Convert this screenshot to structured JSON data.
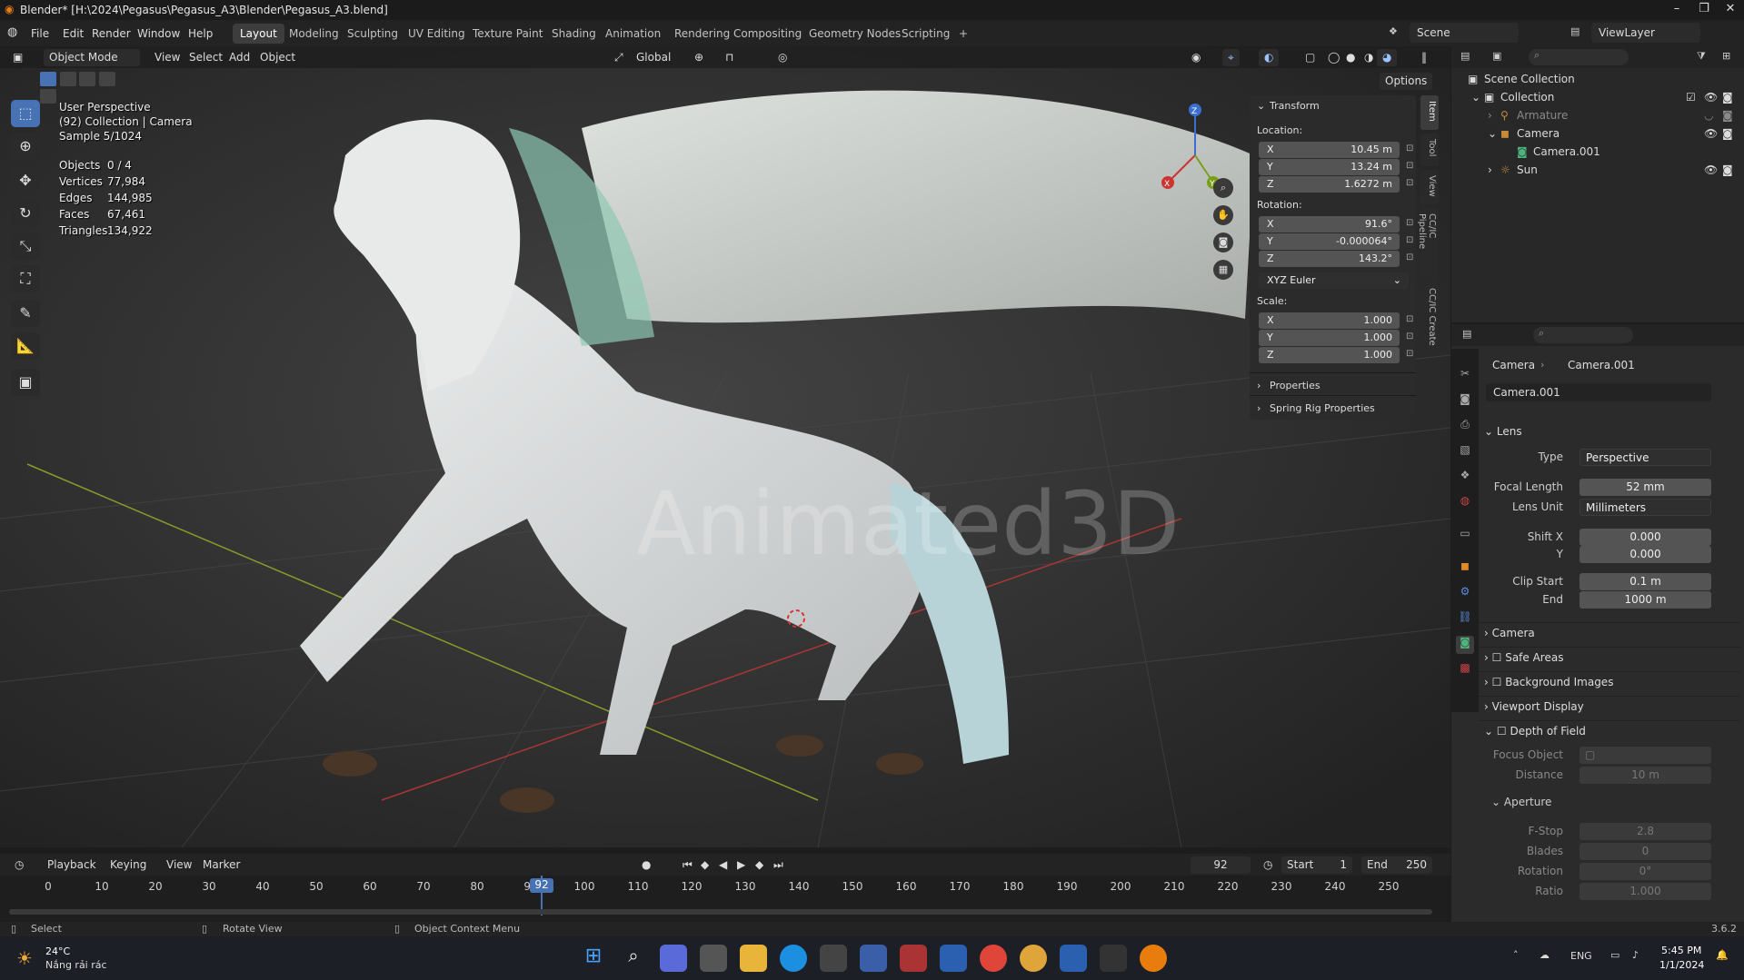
{
  "window": {
    "title": "Blender* [H:\\2024\\Pegasus\\Pegasus_A3\\Blender\\Pegasus_A3.blend]",
    "minimize": "–",
    "maximize": "❐",
    "close": "✕"
  },
  "menu": [
    "File",
    "Edit",
    "Render",
    "Window",
    "Help"
  ],
  "workspaces": [
    "Layout",
    "Modeling",
    "Sculpting",
    "UV Editing",
    "Texture Paint",
    "Shading",
    "Animation",
    "Rendering",
    "Compositing",
    "Geometry Nodes",
    "Scripting",
    "+"
  ],
  "scene": {
    "label": "Scene",
    "view_layer": "ViewLayer"
  },
  "viewport_header": {
    "mode": "Object Mode",
    "menus": [
      "View",
      "Select",
      "Add",
      "Object"
    ],
    "orientation": "Global",
    "options": "Options"
  },
  "overlay": {
    "perspective": "User Perspective",
    "collection": "(92) Collection | Camera",
    "sample": "Sample 5/1024",
    "stats": [
      {
        "label": "Objects",
        "value": "0 / 4"
      },
      {
        "label": "Vertices",
        "value": "77,984"
      },
      {
        "label": "Edges",
        "value": "144,985"
      },
      {
        "label": "Faces",
        "value": "67,461"
      },
      {
        "label": "Triangles",
        "value": "134,922"
      }
    ],
    "watermark": "Animated3D"
  },
  "npanel": {
    "transform": "Transform",
    "location_label": "Location:",
    "location": [
      {
        "axis": "X",
        "value": "10.45 m"
      },
      {
        "axis": "Y",
        "value": "13.24 m"
      },
      {
        "axis": "Z",
        "value": "1.6272 m"
      }
    ],
    "rotation_label": "Rotation:",
    "rotation": [
      {
        "axis": "X",
        "value": "91.6°"
      },
      {
        "axis": "Y",
        "value": "-0.000064°"
      },
      {
        "axis": "Z",
        "value": "143.2°"
      }
    ],
    "rotation_mode": "XYZ Euler",
    "scale_label": "Scale:",
    "scale": [
      {
        "axis": "X",
        "value": "1.000"
      },
      {
        "axis": "Y",
        "value": "1.000"
      },
      {
        "axis": "Z",
        "value": "1.000"
      }
    ],
    "properties": "Properties",
    "spring": "Spring Rig Properties",
    "tabs": [
      "Item",
      "Tool",
      "View",
      "CC/IC Pipeline",
      "CC/IC Create"
    ]
  },
  "outliner": {
    "root": "Scene Collection",
    "items": [
      "Collection",
      "Armature",
      "Camera",
      "Camera.001",
      "Sun"
    ]
  },
  "properties": {
    "breadcrumb_obj": "Camera",
    "breadcrumb_data": "Camera.001",
    "datablock": "Camera.001",
    "lens": "Lens",
    "type_label": "Type",
    "type": "Perspective",
    "focal_label": "Focal Length",
    "focal": "52 mm",
    "lens_unit_label": "Lens Unit",
    "lens_unit": "Millimeters",
    "shiftx_label": "Shift X",
    "shiftx": "0.000",
    "shifty_label": "Y",
    "shifty": "0.000",
    "clip_start_label": "Clip Start",
    "clip_start": "0.1 m",
    "clip_end_label": "End",
    "clip_end": "1000 m",
    "camera": "Camera",
    "safe_areas": "Safe Areas",
    "bg_images": "Background Images",
    "viewport_display": "Viewport Display",
    "dof": "Depth of Field",
    "focus_label": "Focus Object",
    "distance_label": "Distance",
    "distance": "10 m",
    "aperture": "Aperture",
    "fstop_label": "F-Stop",
    "fstop": "2.8",
    "blades_label": "Blades",
    "blades": "0",
    "rotation_label": "Rotation",
    "rotation": "0°",
    "ratio_label": "Ratio",
    "ratio": "1.000"
  },
  "timeline": {
    "menus": [
      "Playback",
      "Keying",
      "View",
      "Marker"
    ],
    "current_frame": "92",
    "start_label": "Start",
    "start": "1",
    "end_label": "End",
    "end": "250",
    "ticks": [
      "0",
      "10",
      "20",
      "30",
      "40",
      "50",
      "60",
      "70",
      "80",
      "90",
      "100",
      "110",
      "120",
      "130",
      "140",
      "150",
      "160",
      "170",
      "180",
      "190",
      "200",
      "210",
      "220",
      "230",
      "240",
      "250"
    ],
    "playhead": "92"
  },
  "status": {
    "select": "Select",
    "rotate": "Rotate View",
    "context": "Object Context Menu",
    "version": "3.6.2"
  },
  "taskbar": {
    "weather_temp": "24°C",
    "weather_desc": "Nắng rải rác",
    "lang": "ENG",
    "time": "5:45 PM",
    "date": "1/1/2024"
  }
}
